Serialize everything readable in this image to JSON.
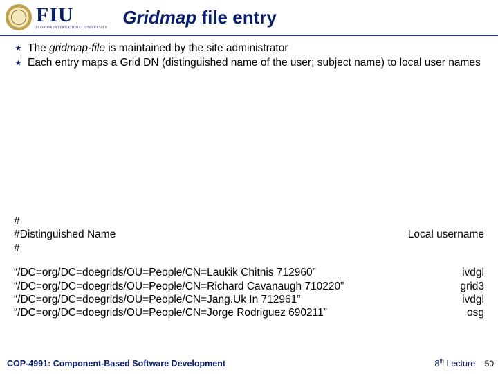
{
  "header": {
    "logo_text": "FIU",
    "logo_sub": "FLORIDA INTERNATIONAL UNIVERSITY",
    "title_italic": "Gridmap",
    "title_plain": " file entry"
  },
  "bullets": [
    {
      "term": "gridmap-file",
      "before": "The ",
      "after": " is maintained by the site administrator"
    },
    {
      "term": "",
      "before": "Each entry maps a Grid DN (distinguished name of the user; subject name) to local user names",
      "after": ""
    }
  ],
  "gridmap": {
    "hash1": "#",
    "dn_label": "#Distinguished Name",
    "local_label": "Local username",
    "hash2": "#",
    "entries": [
      {
        "dn": "“/DC=org/DC=doegrids/OU=People/CN=Laukik Chitnis 712960”",
        "user": "ivdgl"
      },
      {
        "dn": "“/DC=org/DC=doegrids/OU=People/CN=Richard Cavanaugh 710220”",
        "user": "grid3"
      },
      {
        "dn": "“/DC=org/DC=doegrids/OU=People/CN=Jang.Uk In  712961”",
        "user": "ivdgl"
      },
      {
        "dn": "“/DC=org/DC=doegrids/OU=People/CN=Jorge Rodriguez 690211”",
        "user": "osg"
      }
    ]
  },
  "footer": {
    "course": "COP-4991: Component-Based Software Development",
    "lecture_num": "8",
    "lecture_suffix": "th",
    "lecture_word": " Lecture",
    "page": "50"
  }
}
